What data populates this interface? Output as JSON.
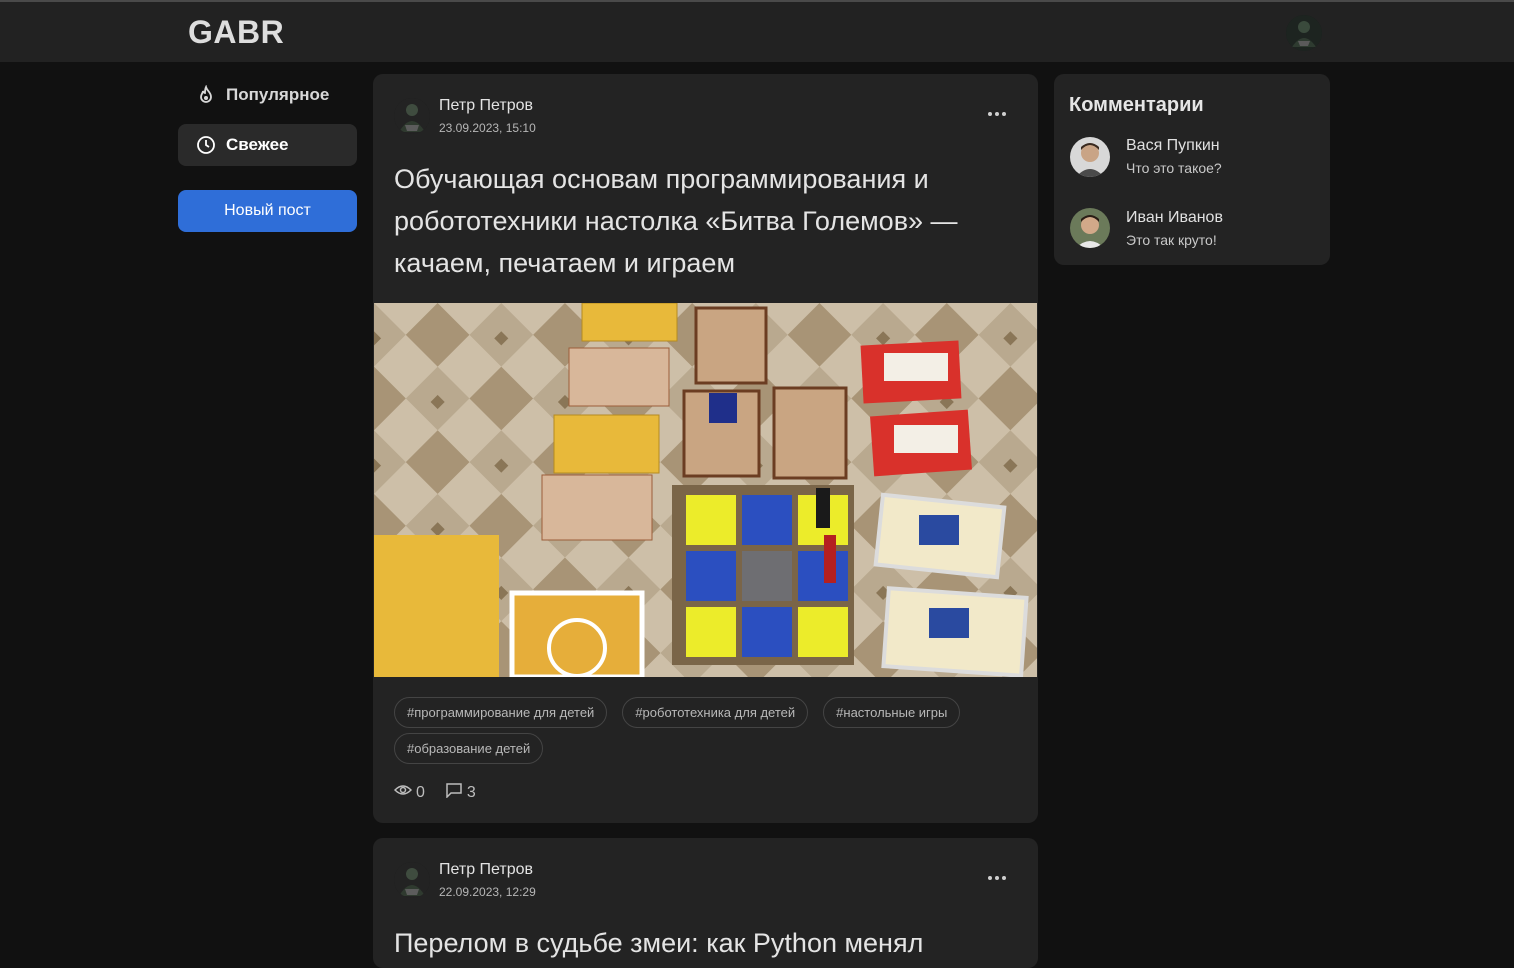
{
  "header": {
    "logo": "GABR",
    "avatar_icon": "user-avatar-icon"
  },
  "sidebar": {
    "items": [
      {
        "label": "Популярное",
        "icon": "fire-icon",
        "active": false
      },
      {
        "label": "Свежее",
        "icon": "clock-icon",
        "active": true
      }
    ],
    "new_post_label": "Новый пост"
  },
  "posts": [
    {
      "author": "Петр Петров",
      "date": "23.09.2023, 15:10",
      "title": "Обучающая основам программирования и робототехники настолка «Битва Големов» — качаем, печатаем и играем",
      "image_icon": "board-game-photo",
      "tags": [
        "#программирование для детей",
        "#робототехника для детей",
        "#настольные игры",
        "#образование детей"
      ],
      "views": "0",
      "comments": "3"
    },
    {
      "author": "Петр Петров",
      "date": "22.09.2023, 12:29",
      "title": "Перелом в судьбе змеи: как Python менял"
    }
  ],
  "comments_panel": {
    "title": "Комментарии",
    "items": [
      {
        "author": "Вася Пупкин",
        "text": "Что это такое?"
      },
      {
        "author": "Иван Иванов",
        "text": "Это так круто!"
      }
    ]
  },
  "colors": {
    "background": "#111111",
    "header": "#222222",
    "card": "#232323",
    "accent": "#2f6ed8"
  }
}
